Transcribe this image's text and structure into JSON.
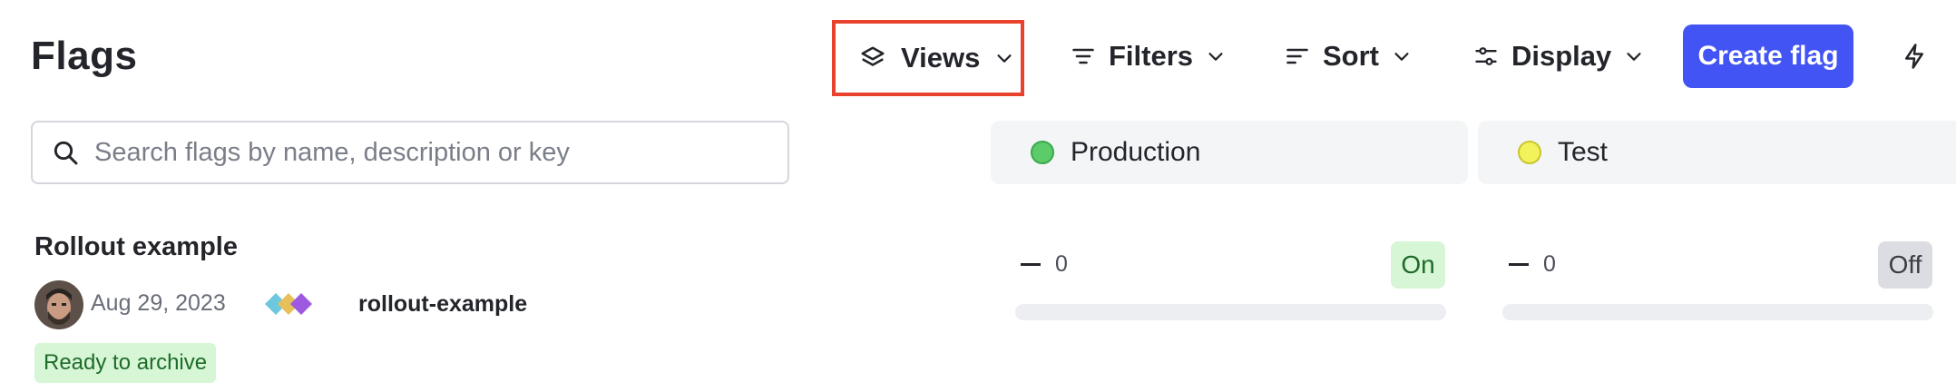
{
  "page": {
    "title": "Flags"
  },
  "toolbar": {
    "views_label": "Views",
    "filters_label": "Filters",
    "sort_label": "Sort",
    "display_label": "Display",
    "create_label": "Create flag",
    "icons": {
      "views": "layers-icon",
      "filters": "filter-icon",
      "sort": "sort-icon",
      "display": "sliders-icon",
      "quick_actions": "bolt-icon"
    }
  },
  "search": {
    "placeholder": "Search flags by name, description or key",
    "value": ""
  },
  "environments": [
    {
      "name": "Production",
      "color": "#5ccc6b"
    },
    {
      "name": "Test",
      "color": "#f3f25a"
    }
  ],
  "flags": [
    {
      "name": "Rollout example",
      "date": "Aug 29, 2023",
      "key": "rollout-example",
      "badge": "Ready to archive",
      "environments": [
        {
          "count": "0",
          "status": "On"
        },
        {
          "count": "0",
          "status": "Off"
        }
      ]
    }
  ],
  "colors": {
    "accent": "#4254f4",
    "highlight_border": "#e8412c",
    "on_bg": "#d7f6d5",
    "off_bg": "#dcdde2"
  }
}
